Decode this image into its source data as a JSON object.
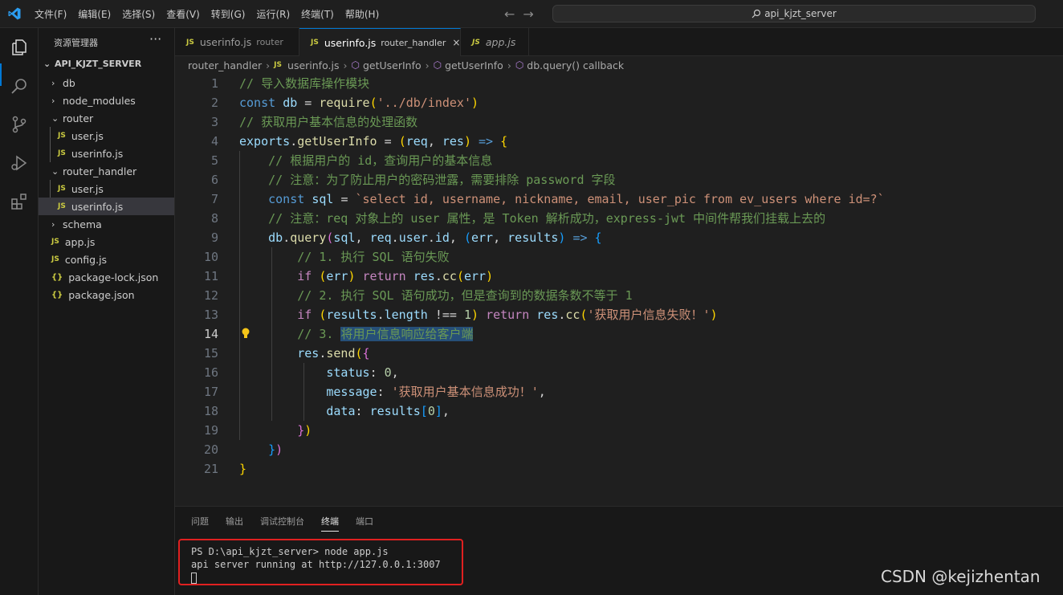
{
  "menu": [
    "文件(F)",
    "编辑(E)",
    "选择(S)",
    "查看(V)",
    "转到(G)",
    "运行(R)",
    "终端(T)",
    "帮助(H)"
  ],
  "nav": {
    "back": "←",
    "forward": "→"
  },
  "search": {
    "text": "api_kjzt_server"
  },
  "sidebar": {
    "title": "资源管理器",
    "more": "···",
    "root": "API_KJZT_SERVER",
    "items": [
      {
        "label": "db",
        "kind": "folder",
        "expanded": false
      },
      {
        "label": "node_modules",
        "kind": "folder",
        "expanded": false
      },
      {
        "label": "router",
        "kind": "folder",
        "expanded": true
      },
      {
        "label": "user.js",
        "kind": "js"
      },
      {
        "label": "userinfo.js",
        "kind": "js"
      },
      {
        "label": "router_handler",
        "kind": "folder",
        "expanded": true
      },
      {
        "label": "user.js",
        "kind": "js"
      },
      {
        "label": "userinfo.js",
        "kind": "js",
        "selected": true
      },
      {
        "label": "schema",
        "kind": "folder",
        "expanded": false
      },
      {
        "label": "app.js",
        "kind": "js"
      },
      {
        "label": "config.js",
        "kind": "js"
      },
      {
        "label": "package-lock.json",
        "kind": "json"
      },
      {
        "label": "package.json",
        "kind": "json"
      }
    ],
    "js_badge": "JS",
    "json_badge": "{}"
  },
  "tabs": [
    {
      "label": "userinfo.js",
      "desc": "router",
      "active": false
    },
    {
      "label": "userinfo.js",
      "desc": "router_handler",
      "active": true,
      "close": "×"
    },
    {
      "label": "app.js",
      "desc": "",
      "active": false
    }
  ],
  "breadcrumbs": [
    "router_handler",
    "userinfo.js",
    "getUserInfo",
    "getUserInfo",
    "db.query() callback"
  ],
  "editor": {
    "line_numbers": [
      "1",
      "2",
      "3",
      "4",
      "5",
      "6",
      "7",
      "8",
      "9",
      "10",
      "11",
      "12",
      "13",
      "14",
      "15",
      "16",
      "17",
      "18",
      "19",
      "20",
      "21"
    ],
    "current_line": 14,
    "lines": [
      "// 导入数据库操作模块",
      "const db = require('../db/index')",
      "// 获取用户基本信息的处理函数",
      "exports.getUserInfo = (req, res) => {",
      "    // 根据用户的 id，查询用户的基本信息",
      "    // 注意：为了防止用户的密码泄露，需要排除 password 字段",
      "    const sql = `select id, username, nickname, email, user_pic from ev_users where id=?`",
      "    // 注意：req 对象上的 user 属性，是 Token 解析成功，express-jwt 中间件帮我们挂载上去的",
      "    db.query(sql, req.user.id, (err, results) => {",
      "        // 1. 执行 SQL 语句失败",
      "        if (err) return res.cc(err)",
      "        // 2. 执行 SQL 语句成功，但是查询到的数据条数不等于 1",
      "        if (results.length !== 1) return res.cc('获取用户信息失败！')",
      "        // 3. 将用户信息响应给客户端",
      "        res.send({",
      "            status: 0,",
      "            message: '获取用户基本信息成功！',",
      "            data: results[0],",
      "        })",
      "    })",
      "}"
    ]
  },
  "panel": {
    "tabs": [
      "问题",
      "输出",
      "调试控制台",
      "终端",
      "端口"
    ],
    "active_tab": "终端",
    "terminal_lines": [
      "PS D:\\api_kjzt_server> node app.js",
      "api server running at http://127.0.0.1:3007"
    ]
  },
  "watermark": "CSDN @kejizhentan",
  "colors": {
    "accent": "#0078d4",
    "highlight_box": "#e02020",
    "selection": "#264f78"
  }
}
